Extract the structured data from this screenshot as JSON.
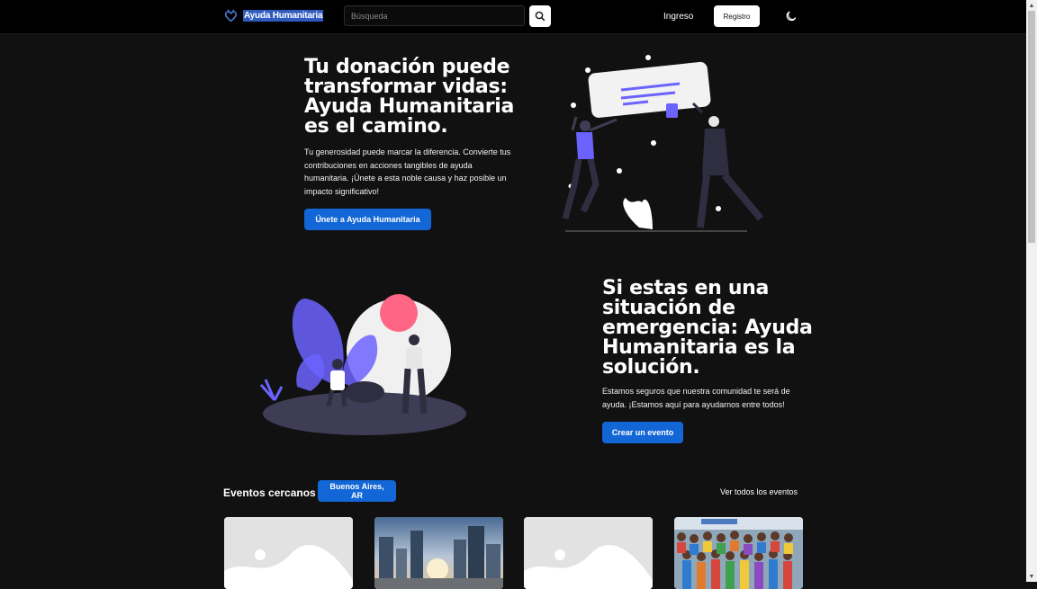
{
  "navbar": {
    "brand_name": "Ayuda Humanitaria",
    "search_placeholder": "Búsqueda",
    "login_label": "Ingreso",
    "register_label": "Registro",
    "search_icon": "search-icon",
    "theme_icon": "moon-icon",
    "logo_icon": "heart-hands-icon"
  },
  "hero1": {
    "title": "Tu donación puede transformar vidas: Ayuda Humanitaria es el camino.",
    "text": "Tu generosidad puede marcar la diferencia. Convierte tus contribuciones en acciones tangibles de ayuda humanitaria. ¡Únete a esta noble causa y haz posible un impacto significativo!",
    "button_label": "Únete a Ayuda Humanitaria"
  },
  "hero2": {
    "title": "Si estas en una situación de emergencia: Ayuda Humanitaria es la solución.",
    "text": "Estamos seguros que nuestra comunidad te será de ayuda. ¡Estamos aquí para ayudarnos entre todos!",
    "button_label": "Crear un evento"
  },
  "events": {
    "title": "Eventos cercanos",
    "location": "Buenos Aires, AR",
    "view_all_label": "Ver todos los eventos",
    "cards": [
      {
        "image": "placeholder-image"
      },
      {
        "image": "city-skyline-photo"
      },
      {
        "image": "placeholder-image"
      },
      {
        "image": "children-group-photo"
      }
    ]
  },
  "colors": {
    "background": "#111111",
    "navbar": "#000000",
    "primary": "#1266d6",
    "accent_purple": "#6c63ff",
    "accent_pink": "#ff6584"
  }
}
